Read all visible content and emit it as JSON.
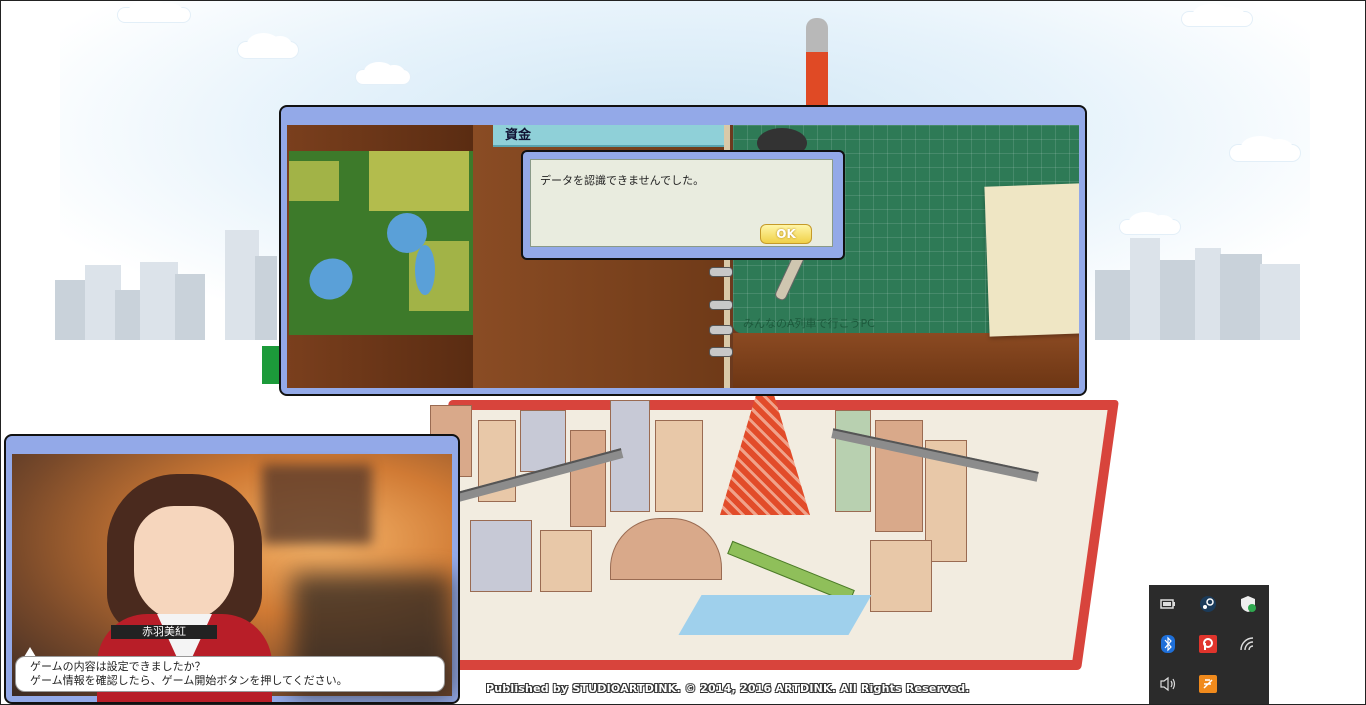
{
  "dialog": {
    "message": "データを認識できませんでした。",
    "ok_label": "OK"
  },
  "game_panel": {
    "funds_tab_label": "資金",
    "board_text": "みんなのA列車で行こうPC"
  },
  "character": {
    "name": "赤羽美紅",
    "dialogue_line1": "ゲームの内容は設定できましたか？",
    "dialogue_line2": "ゲーム情報を確認したら、ゲーム開始ボタンを押してください。"
  },
  "footer": {
    "copyright": "Published by STUDIOARTDINK. © 2014, 2016 ARTDINK. All Rights Reserved."
  },
  "tray": {
    "icons": [
      "battery-icon",
      "steam-icon",
      "security-shield-icon",
      "bluetooth-icon",
      "red-app-icon",
      "wifi-icon",
      "volume-icon",
      "orange-app-icon"
    ]
  },
  "colors": {
    "panel_frame": "#93a9e8",
    "dialog_bg": "#e9ecdf",
    "ok_button": "#f0d048",
    "tray_bg": "#2b2b2b",
    "tower_red": "#e04a25"
  }
}
